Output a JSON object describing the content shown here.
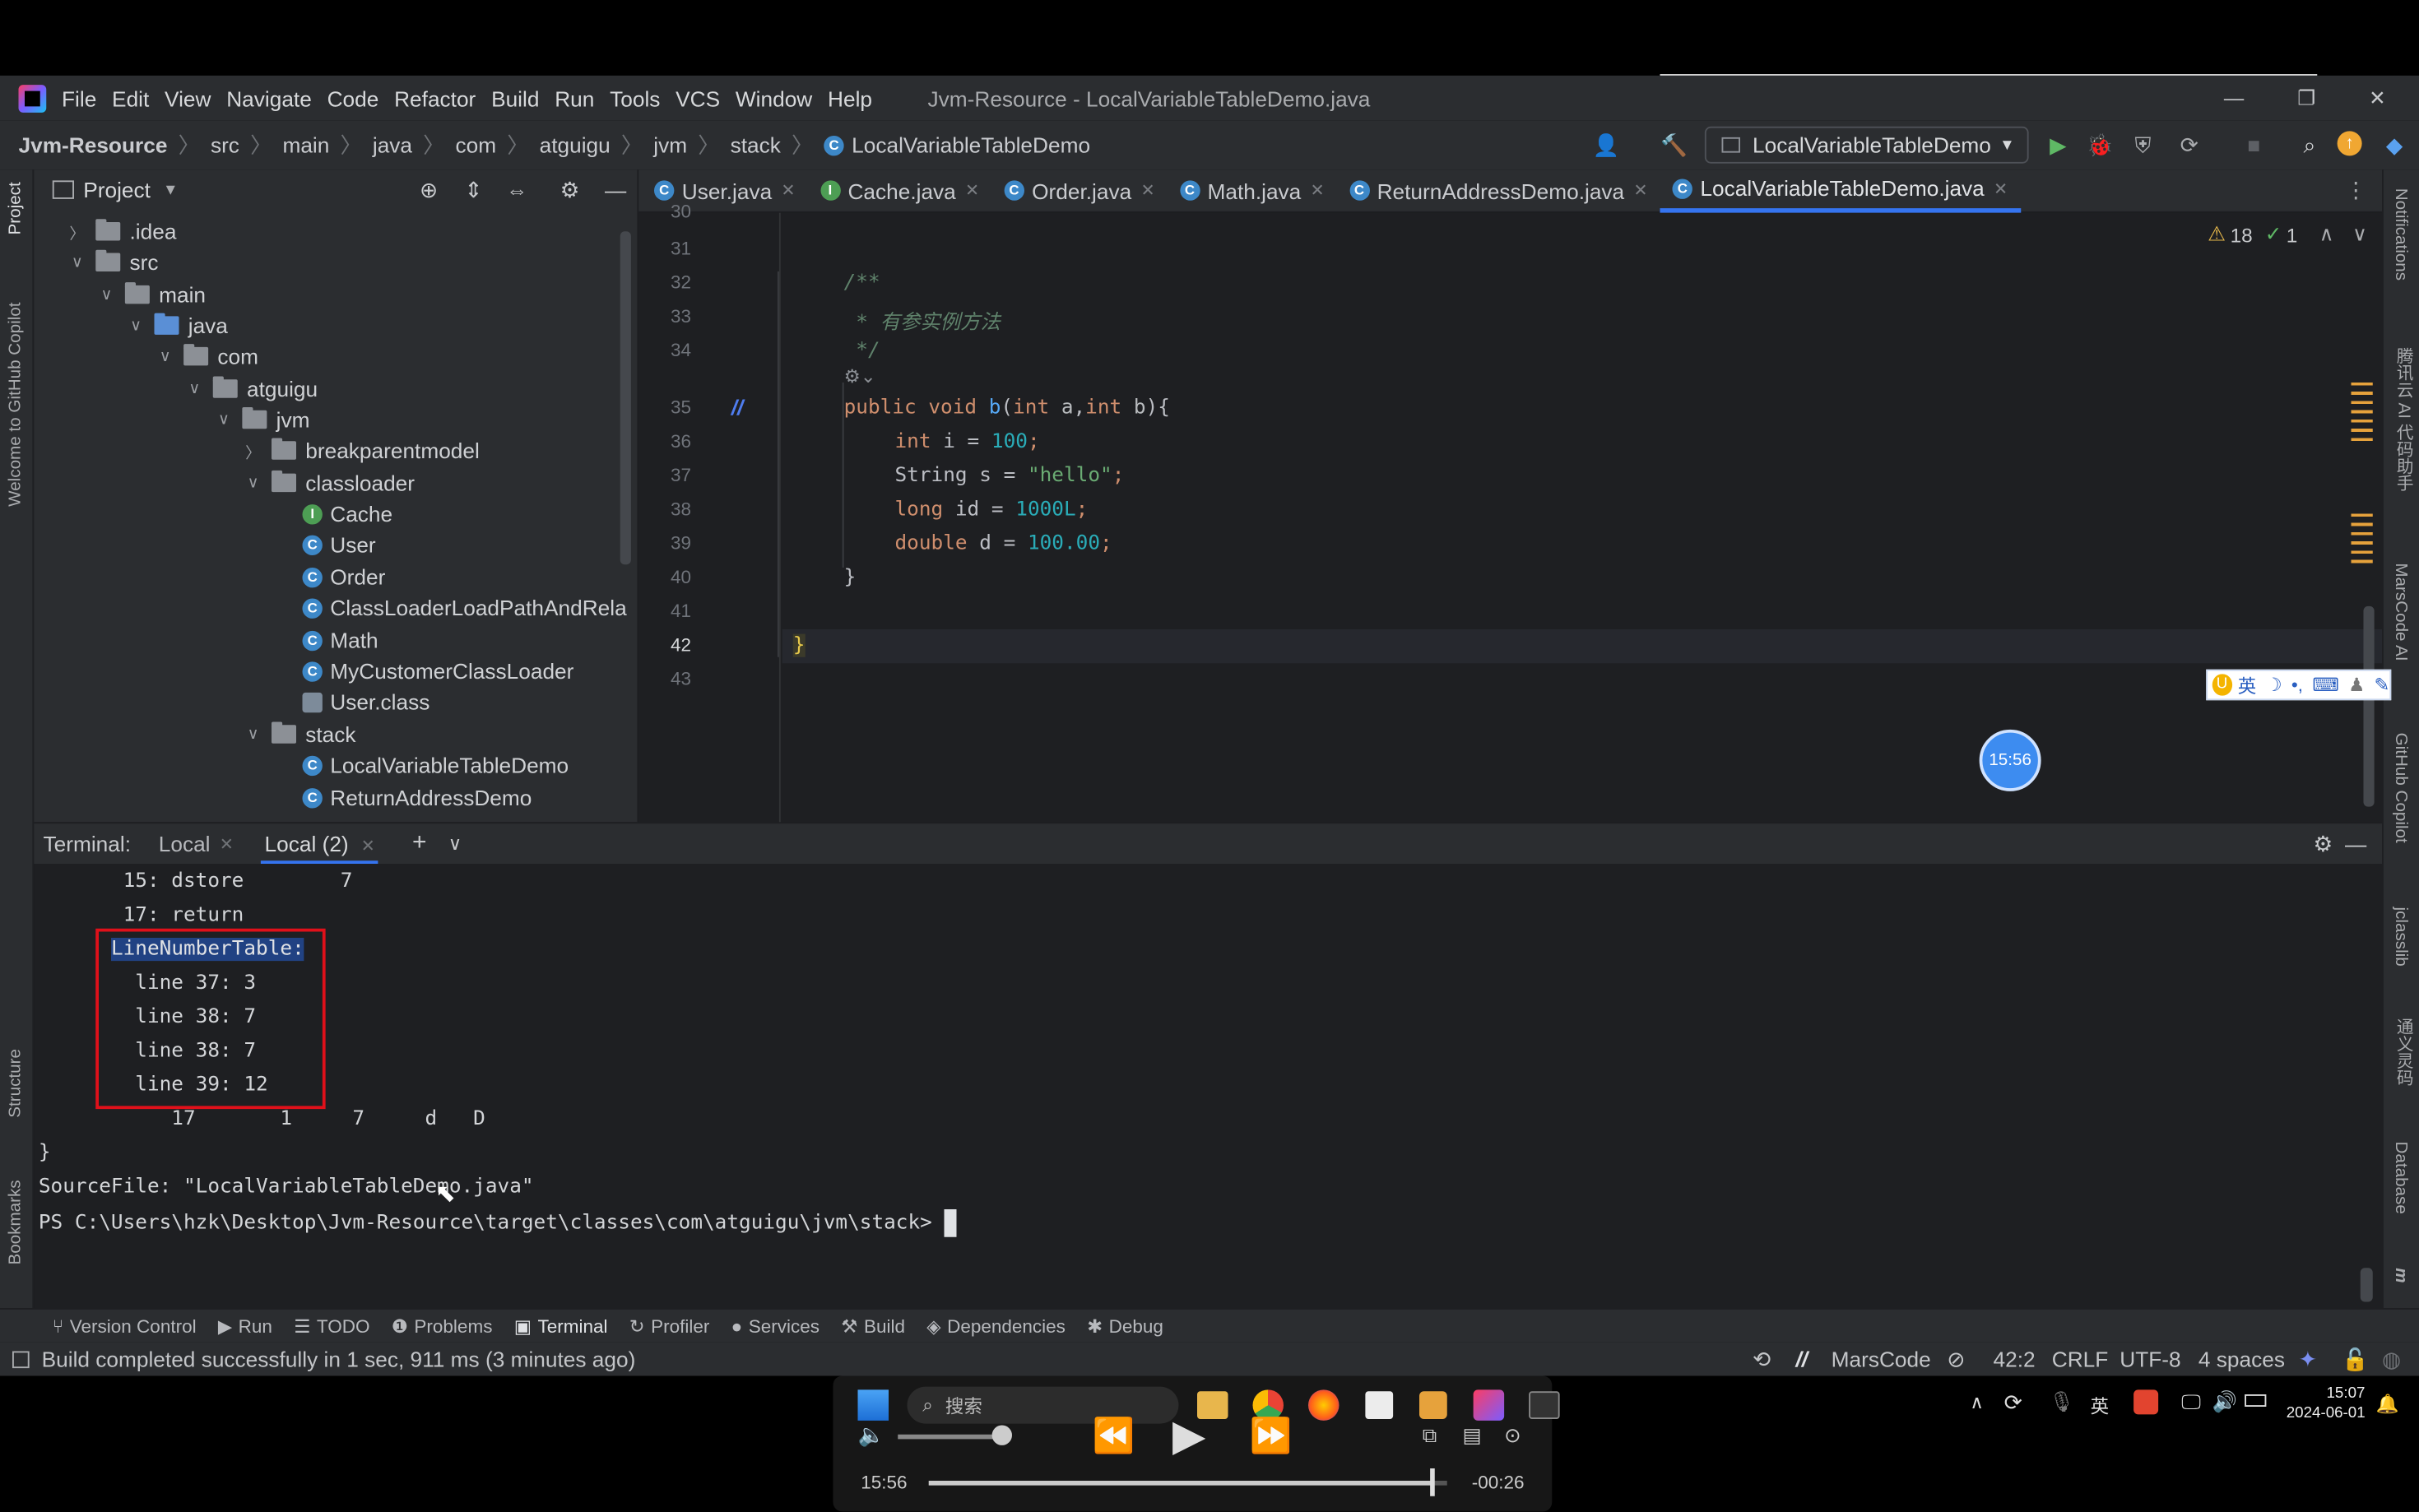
{
  "menu": {
    "items": [
      "File",
      "Edit",
      "View",
      "Navigate",
      "Code",
      "Refactor",
      "Build",
      "Run",
      "Tools",
      "VCS",
      "Window",
      "Help"
    ],
    "window_title": "Jvm-Resource - LocalVariableTableDemo.java"
  },
  "breadcrumb": {
    "items": [
      "Jvm-Resource",
      "src",
      "main",
      "java",
      "com",
      "atguigu",
      "jvm",
      "stack",
      "LocalVariableTableDemo"
    ]
  },
  "run_config": {
    "label": "LocalVariableTableDemo"
  },
  "project": {
    "header": "Project",
    "tree": [
      {
        "label": ".idea"
      },
      {
        "label": "src"
      },
      {
        "label": "main"
      },
      {
        "label": "java"
      },
      {
        "label": "com"
      },
      {
        "label": "atguigu"
      },
      {
        "label": "jvm"
      },
      {
        "label": "breakparentmodel"
      },
      {
        "label": "classloader"
      },
      {
        "label": "Cache"
      },
      {
        "label": "User"
      },
      {
        "label": "Order"
      },
      {
        "label": "ClassLoaderLoadPathAndRela"
      },
      {
        "label": "Math"
      },
      {
        "label": "MyCustomerClassLoader"
      },
      {
        "label": "User.class"
      },
      {
        "label": "stack"
      },
      {
        "label": "LocalVariableTableDemo"
      },
      {
        "label": "ReturnAddressDemo"
      }
    ]
  },
  "tabs": [
    "User.java",
    "Cache.java",
    "Order.java",
    "Math.java",
    "ReturnAddressDemo.java",
    "LocalVariableTableDemo.java"
  ],
  "editor": {
    "inspections": {
      "warnings": "18",
      "ok": "1"
    },
    "line_numbers": [
      "30",
      "31",
      "32",
      "33",
      "34",
      "35",
      "36",
      "37",
      "38",
      "39",
      "40",
      "41",
      "42",
      "43"
    ],
    "code": {
      "l32": "/**",
      "l33": " * 有参实例方法",
      "l34": " */",
      "l35_kw1": "public",
      "l35_kw2": "void",
      "l35_fn": "b",
      "l35_rest1": "(",
      "l35_kw3": "int",
      "l35_p1": " a",
      "l35_rest2": ",",
      "l35_kw4": "int",
      "l35_p2": " b",
      "l35_rest3": "){",
      "l36_kw": "int",
      "l36_var": " i = ",
      "l36_num": "100",
      "l36_end": ";",
      "l37_type": "String",
      "l37_var": " s = ",
      "l37_str": "\"hello\"",
      "l37_end": ";",
      "l38_kw": "long",
      "l38_var": " id = ",
      "l38_num": "1000L",
      "l38_end": ";",
      "l39_kw": "double",
      "l39_var": " d = ",
      "l39_num": "100.00",
      "l39_end": ";",
      "l40": "}",
      "l42": "}"
    },
    "clock_bubble": "15:56",
    "ime_bar": "英"
  },
  "terminal": {
    "label": "Terminal:",
    "tabs": [
      "Local",
      "Local (2)"
    ],
    "lines": [
      "       15: dstore        7",
      "       17: return",
      "      LineNumberTable:",
      "        line 37: 3",
      "        line 38: 7",
      "        line 38: 7",
      "        line 39: 12",
      "           17       1     7     d   D",
      "}",
      "SourceFile: \"LocalVariableTableDemo.java\"",
      "PS C:\\Users\\hzk\\Desktop\\Jvm-Resource\\target\\classes\\com\\atguigu\\jvm\\stack> "
    ]
  },
  "toolwindows": [
    "Version Control",
    "Run",
    "TODO",
    "Problems",
    "Terminal",
    "Profiler",
    "Services",
    "Build",
    "Dependencies",
    "Debug"
  ],
  "status": {
    "message": "Build completed successfully in 1 sec, 911 ms (3 minutes ago)",
    "marscode": "MarsCode",
    "position": "42:2",
    "line_sep": "CRLF",
    "encoding": "UTF-8",
    "indent": "4 spaces"
  },
  "side_left": [
    "Project",
    "Welcome to GitHub Copilot",
    "Structure",
    "Bookmarks"
  ],
  "side_right": [
    "Notifications",
    "腾讯云 AI 代码助手",
    "MarsCode AI",
    "GitHub Copilot",
    "jclasslib",
    "通义灵码",
    "Database",
    "m"
  ],
  "taskbar": {
    "search_placeholder": "搜索",
    "time": "15:07",
    "date": "2024-06-01",
    "ime": "英"
  },
  "player": {
    "elapsed": "15:56",
    "remaining": "-00:26",
    "progress": 0.97
  }
}
